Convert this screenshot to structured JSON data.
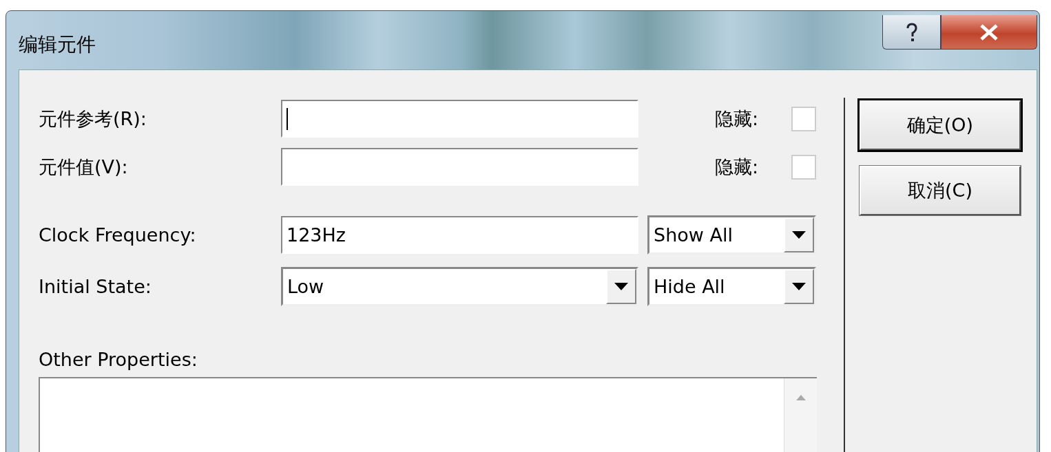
{
  "window": {
    "title": "编辑元件"
  },
  "fields": [
    {
      "label": "元件参考(R):",
      "focused": true,
      "hide_label": "隐藏:",
      "hidden": false
    },
    {
      "label": "元件值(V):",
      "focused": false,
      "hide_label": "隐藏:",
      "hidden": false
    }
  ],
  "properties": [
    {
      "kind": "text",
      "label": "Clock Frequency:",
      "value": "123Hz",
      "visibility": "Show All"
    },
    {
      "kind": "dropdown",
      "label": "Initial State:",
      "value": "Low",
      "visibility": "Hide All"
    }
  ],
  "other_properties": {
    "label": "Other Properties:"
  },
  "buttons": [
    {
      "label": "确定(O)",
      "default": true
    },
    {
      "label": "取消(C)",
      "default": false
    }
  ]
}
